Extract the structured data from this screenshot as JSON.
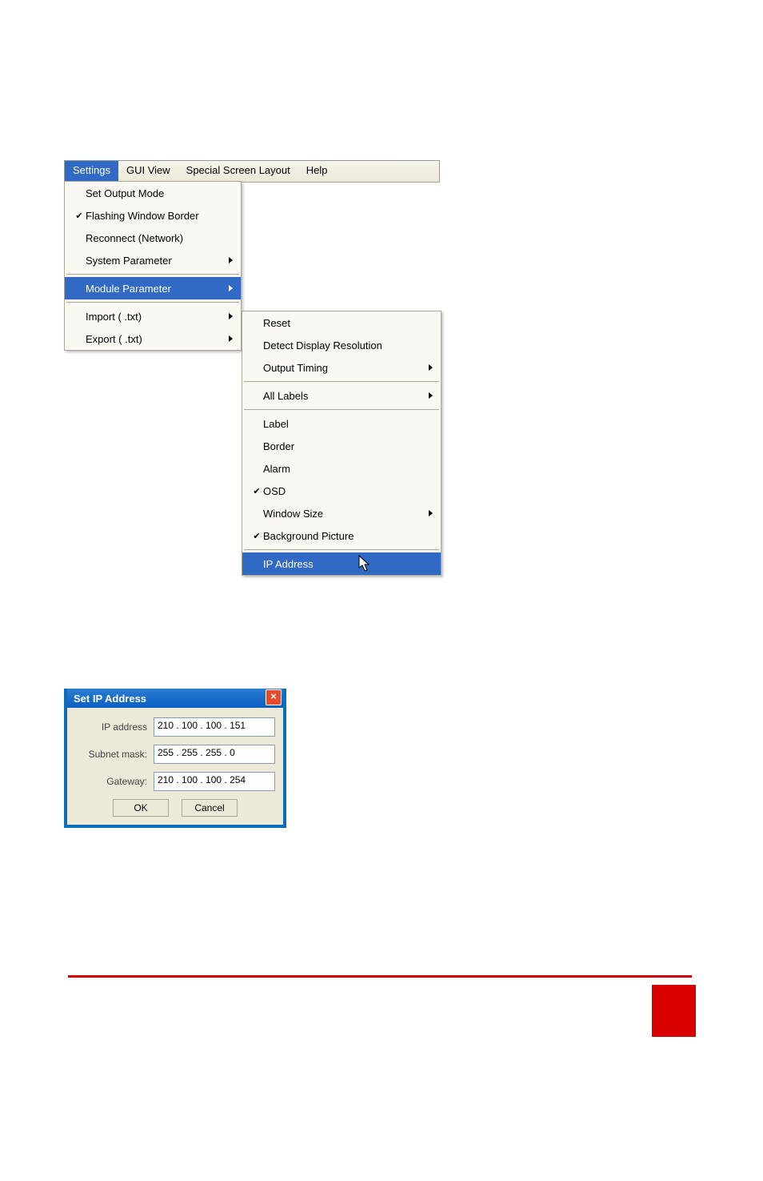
{
  "menubar": {
    "items": [
      "Settings",
      "GUI View",
      "Special Screen Layout",
      "Help"
    ],
    "active_index": 0
  },
  "settings_menu": {
    "items": [
      {
        "label": "Set Output Mode",
        "checked": false,
        "submenu": false
      },
      {
        "label": "Flashing Window Border",
        "checked": true,
        "submenu": false
      },
      {
        "label": "Reconnect (Network)",
        "checked": false,
        "submenu": false
      },
      {
        "label": "System Parameter",
        "checked": false,
        "submenu": true
      },
      {
        "label": "Module Parameter",
        "checked": false,
        "submenu": true,
        "highlight": true
      },
      {
        "label": "Import ( .txt)",
        "checked": false,
        "submenu": true
      },
      {
        "label": "Export ( .txt)",
        "checked": false,
        "submenu": true
      }
    ]
  },
  "module_submenu": {
    "items": [
      {
        "label": "Reset",
        "checked": false,
        "submenu": false
      },
      {
        "label": "Detect Display Resolution",
        "checked": false,
        "submenu": false
      },
      {
        "label": "Output Timing",
        "checked": false,
        "submenu": true
      },
      {
        "sep": true
      },
      {
        "label": "All Labels",
        "checked": false,
        "submenu": true
      },
      {
        "sep": true
      },
      {
        "label": "Label",
        "checked": false,
        "submenu": false
      },
      {
        "label": "Border",
        "checked": false,
        "submenu": false
      },
      {
        "label": "Alarm",
        "checked": false,
        "submenu": false
      },
      {
        "label": "OSD",
        "checked": true,
        "submenu": false
      },
      {
        "label": "Window Size",
        "checked": false,
        "submenu": true
      },
      {
        "label": "Background Picture",
        "checked": true,
        "submenu": false
      },
      {
        "sep": true
      },
      {
        "label": "IP Address",
        "checked": false,
        "submenu": false,
        "highlight": true
      }
    ]
  },
  "dialog": {
    "title": "Set IP Address",
    "rows": [
      {
        "label": "IP address",
        "value": "210 . 100 . 100 . 151"
      },
      {
        "label": "Subnet mask:",
        "value": "255 . 255 . 255 .   0"
      },
      {
        "label": "Gateway:",
        "value": "210 . 100 . 100 . 254"
      }
    ],
    "ok": "OK",
    "cancel": "Cancel"
  }
}
